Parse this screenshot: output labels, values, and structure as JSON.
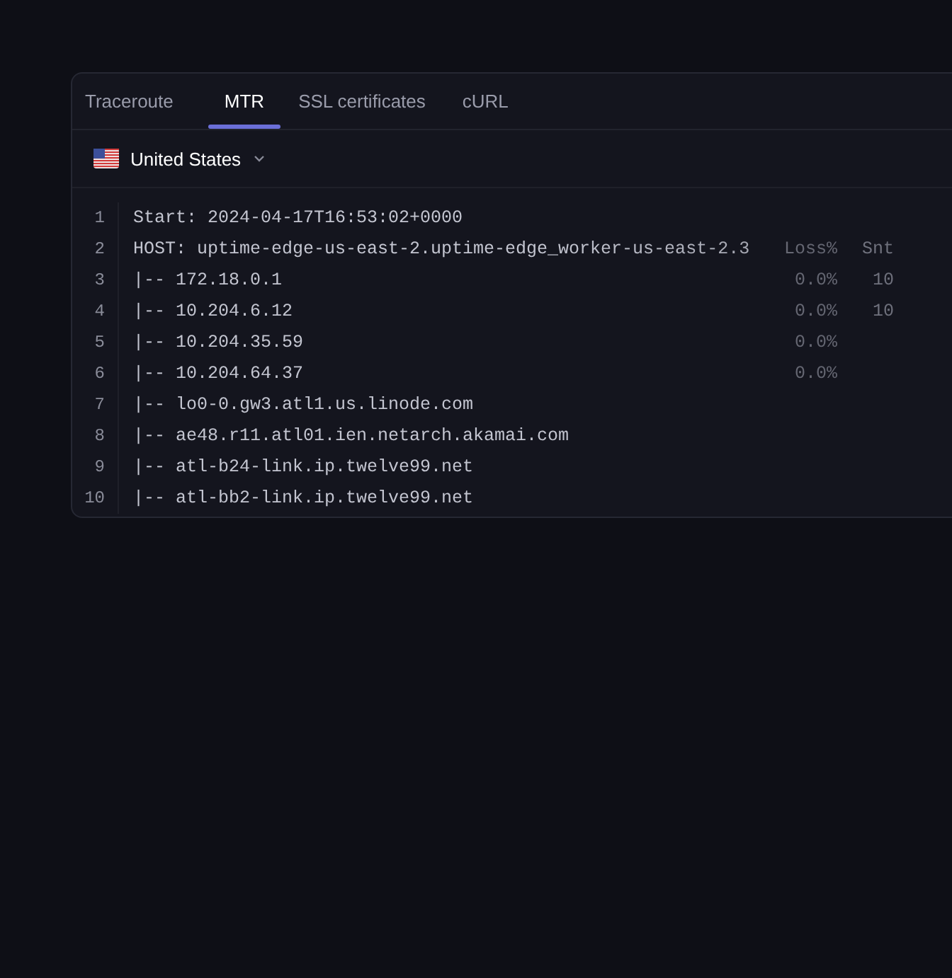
{
  "tabs": [
    {
      "label": "Traceroute",
      "selected": false
    },
    {
      "label": "MTR",
      "selected": true
    },
    {
      "label": "SSL certificates",
      "selected": false
    },
    {
      "label": "cURL",
      "selected": false
    }
  ],
  "location": {
    "label": "United States"
  },
  "output": {
    "lines": [
      {
        "number": "1",
        "text": "Start: 2024-04-17T16:53:02+0000"
      },
      {
        "number": "2",
        "text": "HOST: uptime-edge-us-east-2.uptime-edge_worker-us-east-2.3",
        "loss": "Loss%",
        "sent": "Snt"
      },
      {
        "number": "3",
        "text": "|-- 172.18.0.1",
        "loss": "0.0%",
        "sent": "10"
      },
      {
        "number": "4",
        "text": "|-- 10.204.6.12",
        "loss": "0.0%",
        "sent": "10"
      },
      {
        "number": "5",
        "text": "|-- 10.204.35.59",
        "loss": "0.0%"
      },
      {
        "number": "6",
        "text": "|-- 10.204.64.37",
        "loss": "0.0%"
      },
      {
        "number": "7",
        "text": "|-- lo0-0.gw3.atl1.us.linode.com"
      },
      {
        "number": "8",
        "text": "|-- ae48.r11.atl01.ien.netarch.akamai.com"
      },
      {
        "number": "9",
        "text": "|-- atl-b24-link.ip.twelve99.net"
      },
      {
        "number": "10",
        "text": "|-- atl-bb2-link.ip.twelve99.net"
      }
    ]
  }
}
